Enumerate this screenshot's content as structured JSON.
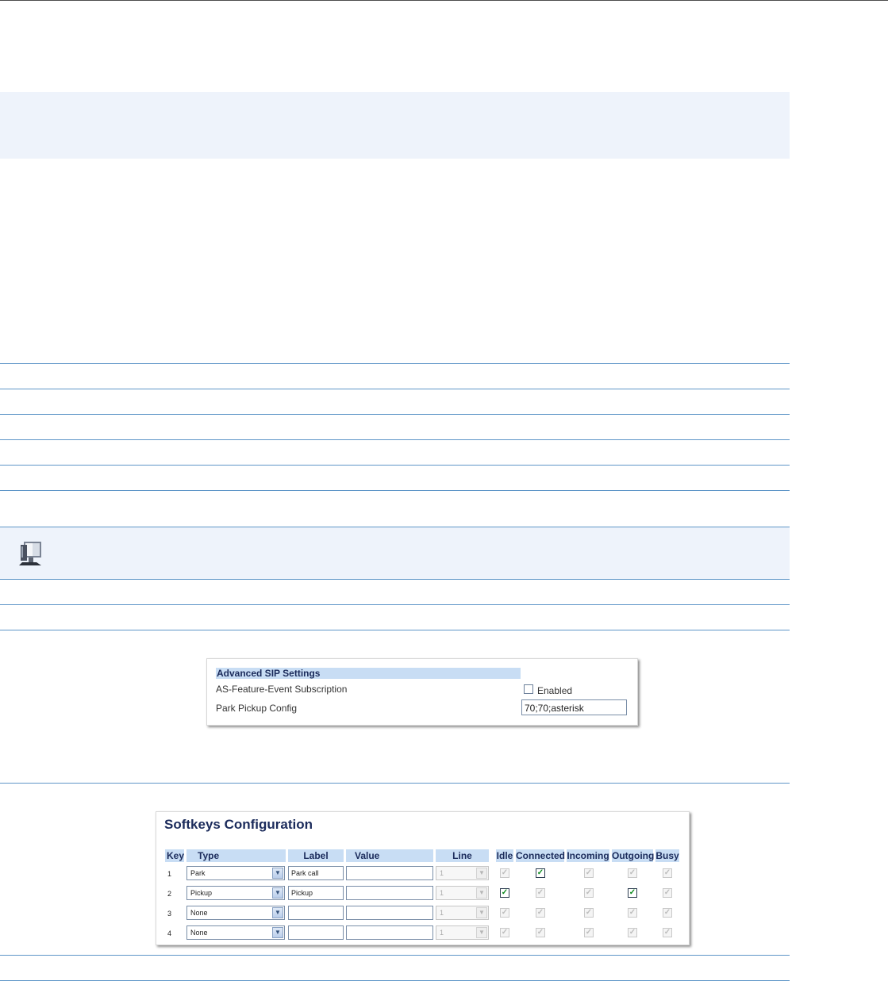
{
  "sip_settings": {
    "header": "Advanced SIP Settings",
    "row1_label": "AS-Feature-Event Subscription",
    "row1_checkbox_label": "Enabled",
    "row2_label": "Park Pickup Config",
    "row2_value": "70;70;asterisk"
  },
  "softkeys": {
    "title": "Softkeys Configuration",
    "headers": {
      "key": "Key",
      "type": "Type",
      "label": "Label",
      "value": "Value",
      "line": "Line",
      "idle": "Idle",
      "connected": "Connected",
      "incoming": "Incoming",
      "outgoing": "Outgoing",
      "busy": "Busy"
    },
    "rows": [
      {
        "key": "1",
        "type": "Park",
        "label": "Park call",
        "value": "",
        "line": "1"
      },
      {
        "key": "2",
        "type": "Pickup",
        "label": "Pickup",
        "value": "",
        "line": "1"
      },
      {
        "key": "3",
        "type": "None",
        "label": "",
        "value": "",
        "line": "1"
      },
      {
        "key": "4",
        "type": "None",
        "label": "",
        "value": "",
        "line": "1"
      }
    ]
  }
}
